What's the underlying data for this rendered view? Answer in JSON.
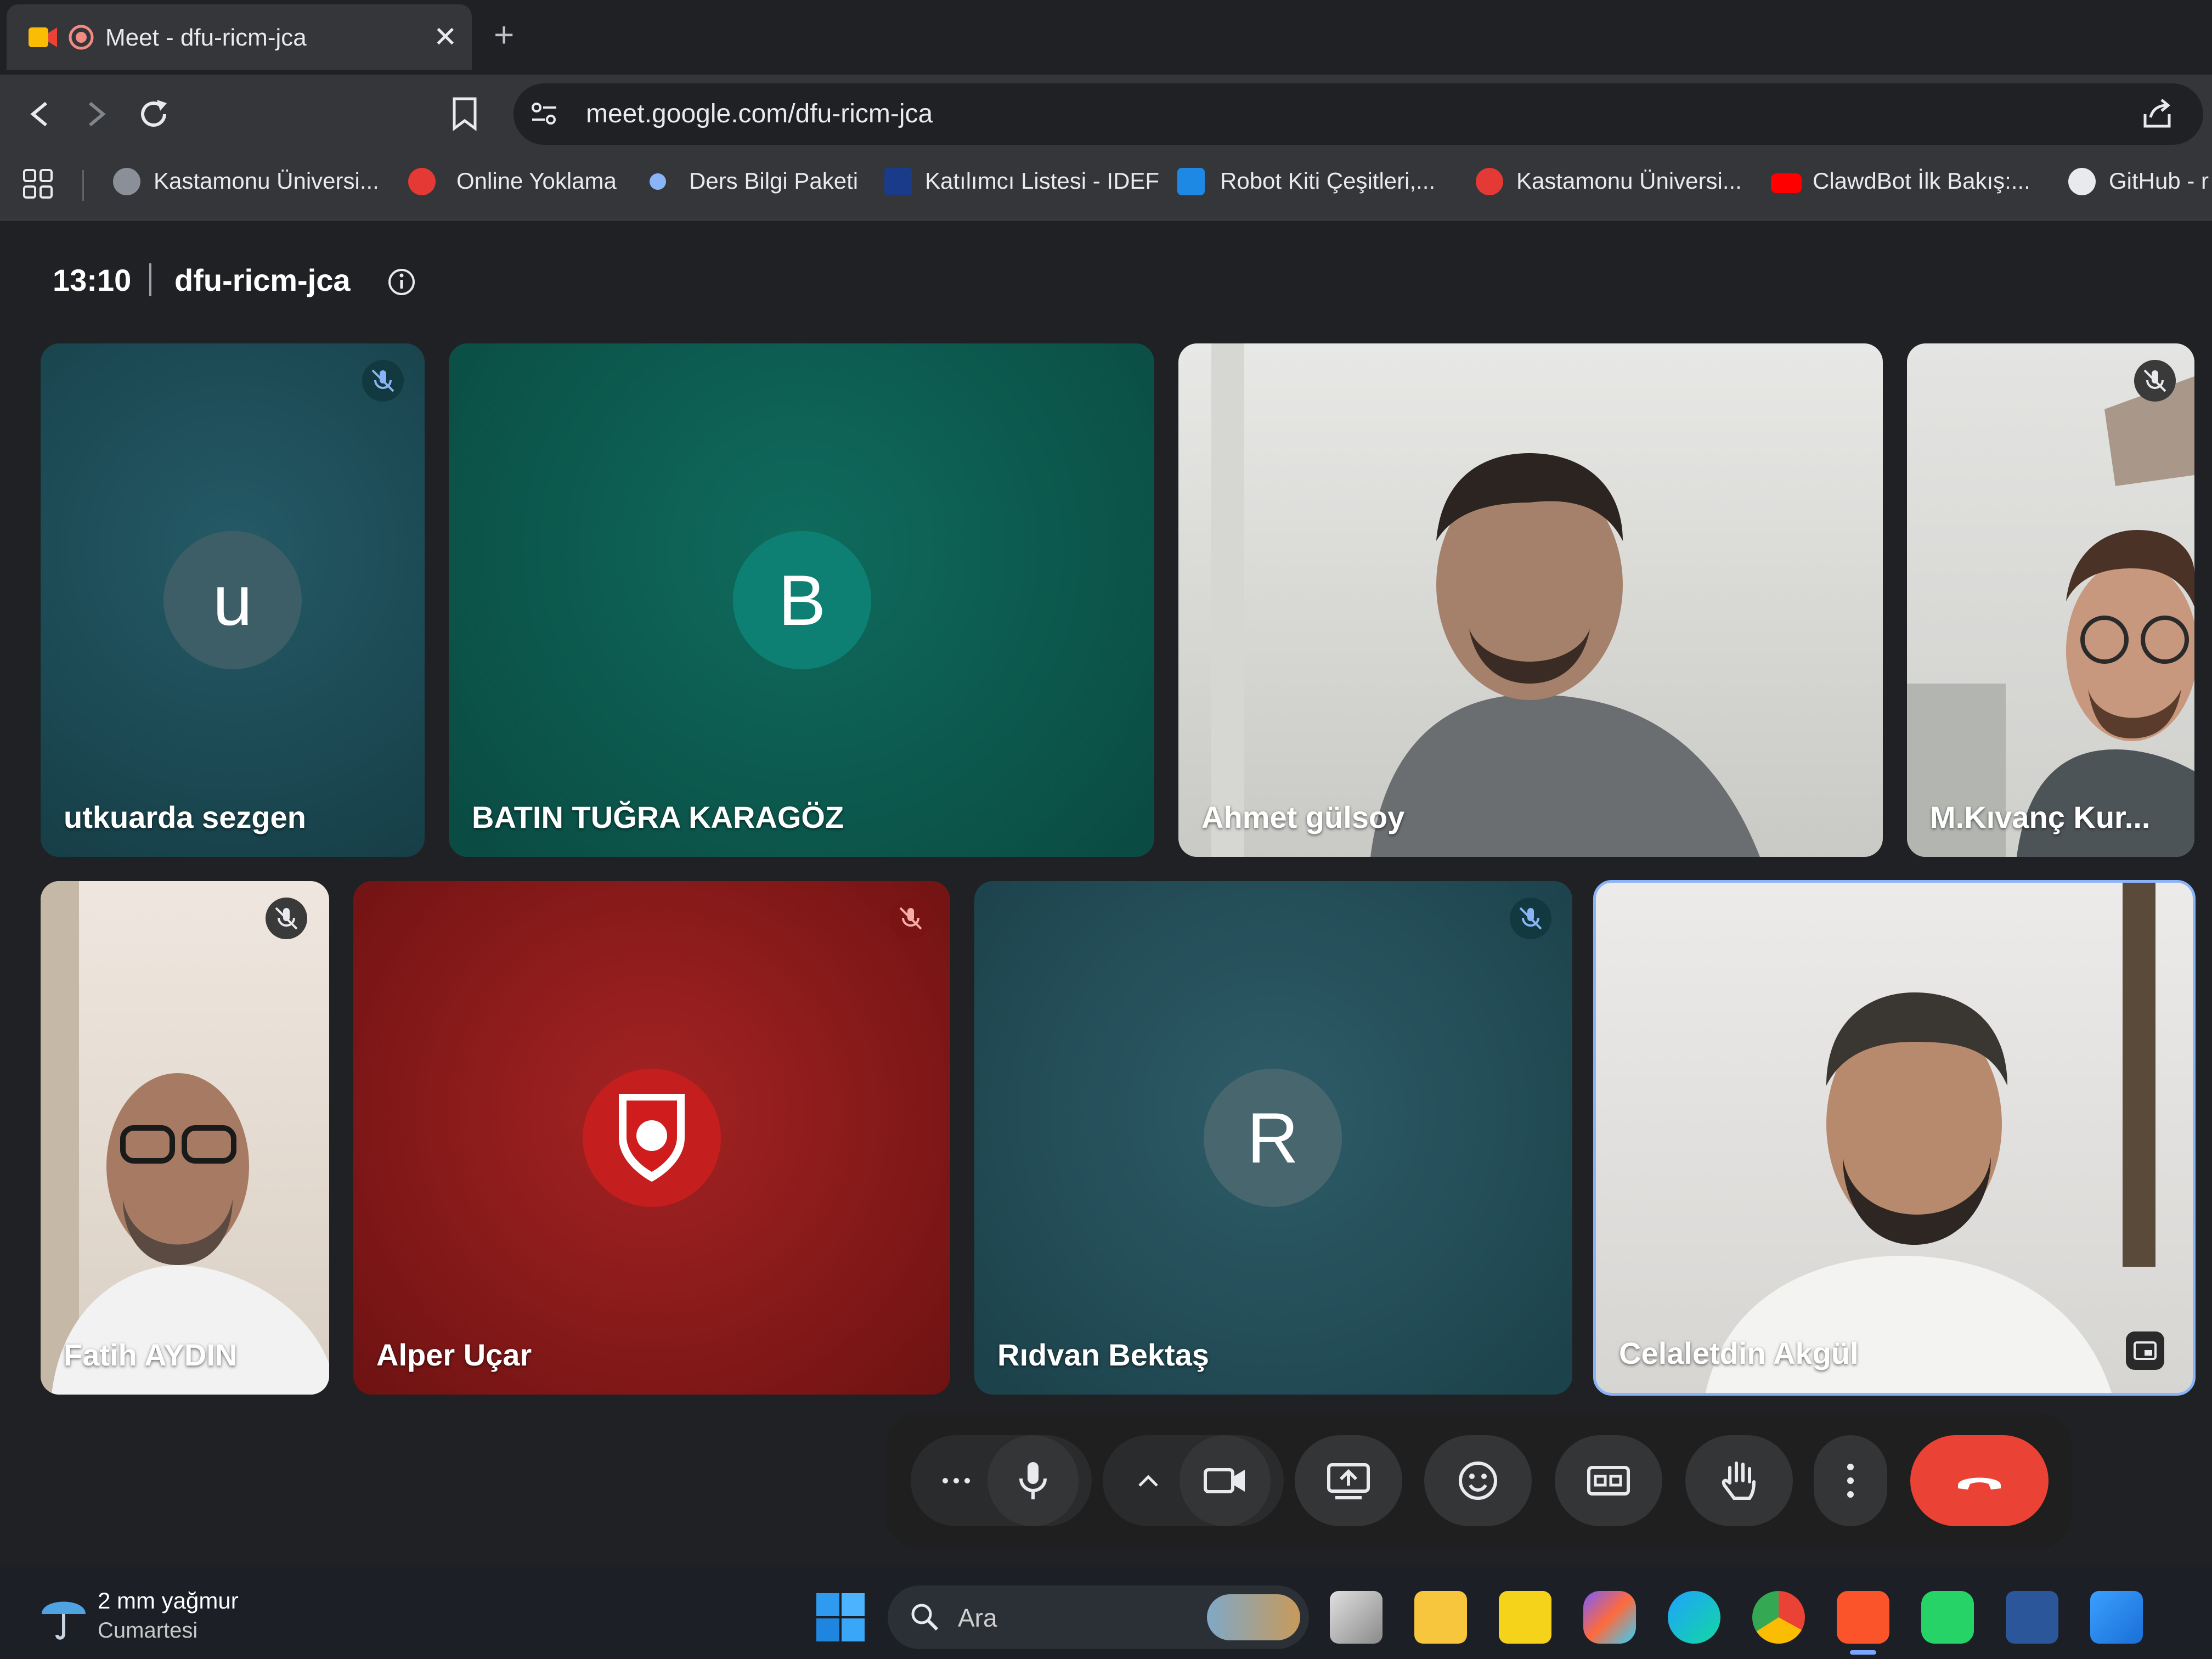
{
  "browser": {
    "tab_title": "Meet - dfu-ricm-jca",
    "tab_close": "✕",
    "new_tab": "+",
    "url": "meet.google.com/dfu-ricm-jca"
  },
  "bookmarks": [
    {
      "label": "Kastamonu Üniversi...",
      "color": "#8a8f98"
    },
    {
      "label": "Online Yoklama",
      "color": "#e53935"
    },
    {
      "label": "Ders Bilgi Paketi",
      "color": "#8ab4f8"
    },
    {
      "label": "Katılımcı Listesi - IDEF",
      "color": "#1a3a8a"
    },
    {
      "label": "Robot Kiti Çeşitleri,...",
      "color": "#1e88e5"
    },
    {
      "label": "Kastamonu Üniversi...",
      "color": "#e53935"
    },
    {
      "label": "ClawdBot İlk Bakış:...",
      "color": "#ff0000"
    },
    {
      "label": "GitHub - r",
      "color": "#e8eaed"
    }
  ],
  "meeting": {
    "time": "13:10",
    "code": "dfu-ricm-jca"
  },
  "participants": [
    {
      "name": "utkuarda sezgen",
      "initial": "u",
      "muted": true
    },
    {
      "name": "BATIN TUĞRA KARAGÖZ",
      "initial": "B",
      "muted": false
    },
    {
      "name": "Ahmet gülsoy",
      "muted": false
    },
    {
      "name": "M.Kıvanç Kur...",
      "muted": true
    },
    {
      "name": "Fatih AYDIN",
      "muted": true
    },
    {
      "name": "Alper Uçar",
      "muted": true
    },
    {
      "name": "Rıdvan Bektaş",
      "initial": "R",
      "muted": true
    },
    {
      "name": "Celaletdin Akgül",
      "muted": false
    }
  ],
  "taskbar": {
    "weather_temp": "2 mm yağmur",
    "weather_day": "Cumartesi",
    "search_placeholder": "Ara"
  },
  "colors": {
    "end_call": "#ea4335",
    "tile_teal": "#1f4e57",
    "tile_green": "#0b5c52",
    "tile_red": "#8b1a1a",
    "active_border": "#8ab4f8"
  }
}
